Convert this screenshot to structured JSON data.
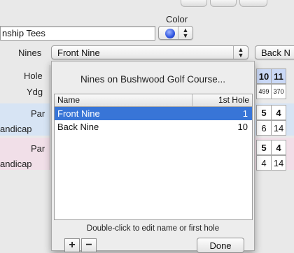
{
  "header": {
    "color_label": "Color",
    "tee_name_value": "nship Tees",
    "nines_label": "Nines",
    "nines_selected": "Front Nine",
    "back_button_partial": "Back N"
  },
  "grid": {
    "row_labels": {
      "hole": "Hole",
      "ydg": "Ydg",
      "par1": "Par",
      "handicap1": "andicap",
      "par2": "Par",
      "handicap2": "andicap"
    },
    "hole_cells": [
      "10",
      "11"
    ],
    "ydg_cells": [
      "499",
      "370"
    ],
    "par1_cells": [
      "5",
      "4"
    ],
    "handicap1_cells": [
      "6",
      "14"
    ],
    "par2_cells": [
      "5",
      "4"
    ],
    "handicap2_cells": [
      "4",
      "14"
    ]
  },
  "sheet": {
    "title": "Nines on Bushwood Golf Course...",
    "columns": {
      "name": "Name",
      "first_hole": "1st Hole"
    },
    "rows": [
      {
        "name": "Front Nine",
        "first_hole": "1"
      },
      {
        "name": "Back Nine",
        "first_hole": "10"
      }
    ],
    "hint": "Double-click to edit name or first hole",
    "add_label": "+",
    "remove_label": "−",
    "done_label": "Done"
  },
  "colors": {
    "selection": "#3875d7",
    "swatch": "#2f54e0",
    "par_row_blue": "#d7e4f4",
    "par_row_pink": "#f1dfe8"
  }
}
